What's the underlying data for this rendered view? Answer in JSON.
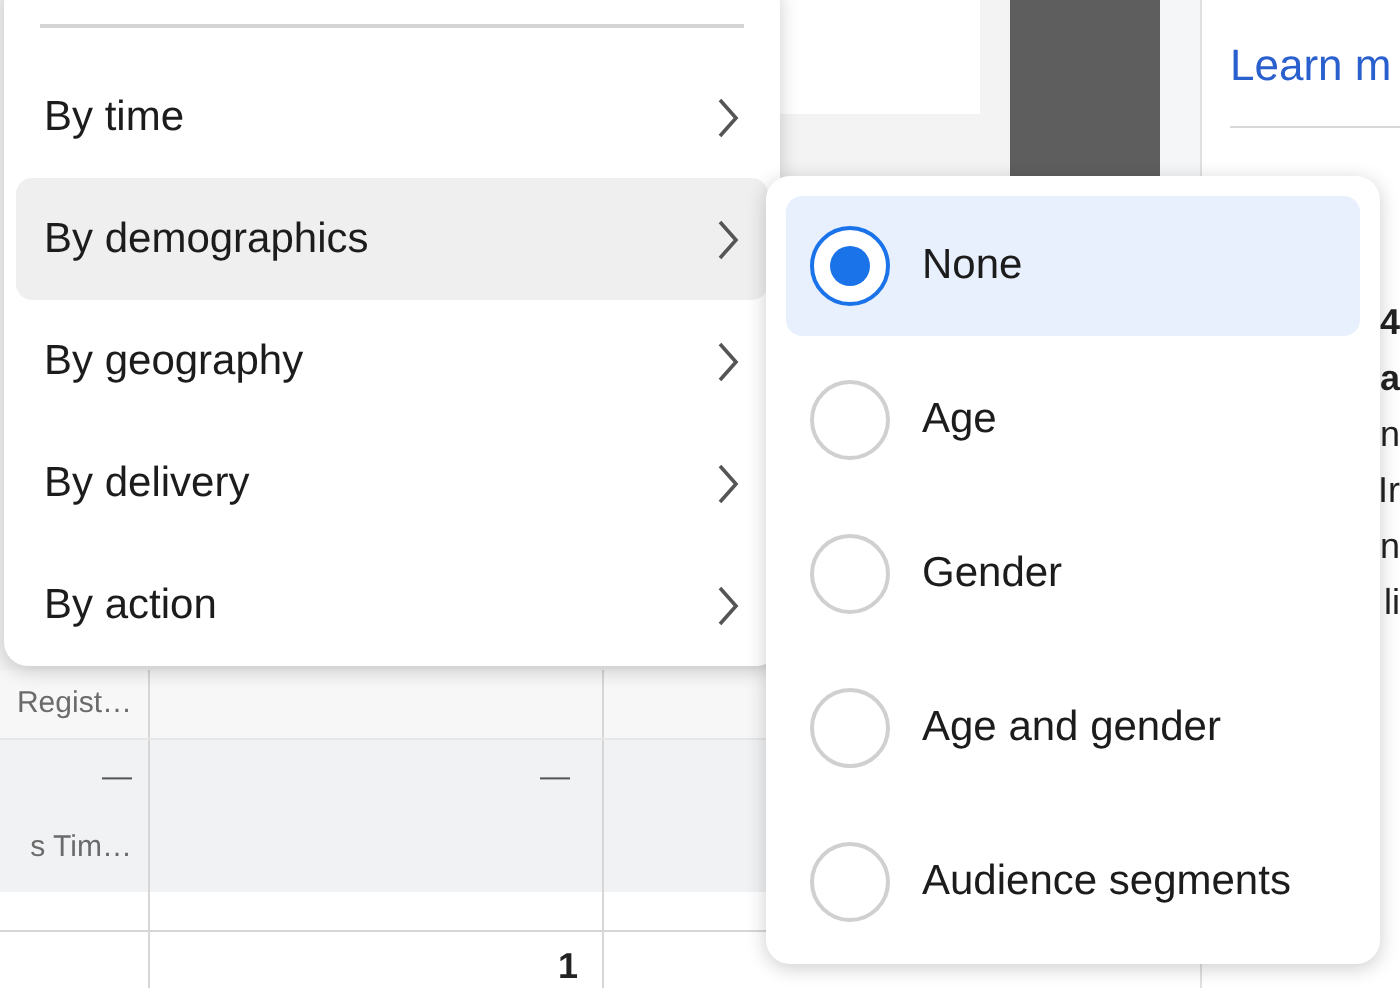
{
  "side_panel": {
    "link": "Learn m",
    "fragments": [
      {
        "text": "4",
        "bold": true
      },
      {
        "text": "a",
        "bold": true
      },
      {
        "text": "n",
        "bold": false
      },
      {
        "text": "Ir",
        "bold": false
      },
      {
        "text": "n",
        "bold": false
      },
      {
        "text": "li",
        "bold": false
      }
    ]
  },
  "table": {
    "header_label": "Regist…",
    "row": {
      "column_1": "—",
      "column_2": "—",
      "label": "s Tim…"
    },
    "next_row": {
      "column_2": "1"
    }
  },
  "menu": {
    "items": [
      {
        "label": "By time",
        "selected": false
      },
      {
        "label": "By demographics",
        "selected": true
      },
      {
        "label": "By geography",
        "selected": false
      },
      {
        "label": "By delivery",
        "selected": false
      },
      {
        "label": "By action",
        "selected": false
      }
    ]
  },
  "submenu": {
    "options": [
      {
        "label": "None",
        "selected": true
      },
      {
        "label": "Age",
        "selected": false
      },
      {
        "label": "Gender",
        "selected": false
      },
      {
        "label": "Age and gender",
        "selected": false
      },
      {
        "label": "Audience segments",
        "selected": false
      }
    ]
  }
}
